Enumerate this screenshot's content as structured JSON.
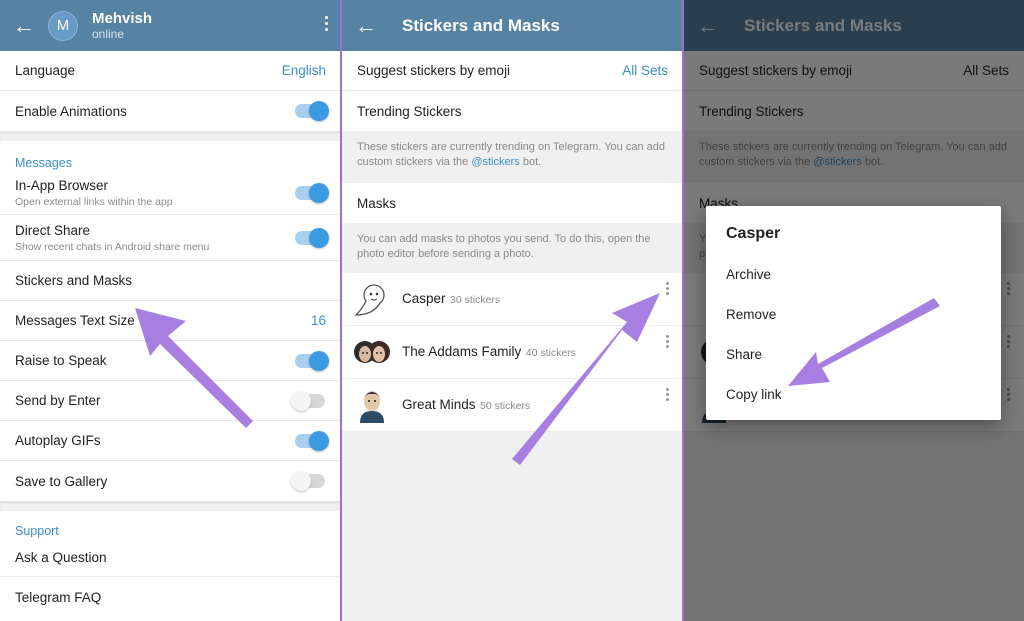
{
  "panel1": {
    "header": {
      "avatar_letter": "M",
      "name": "Mehvish",
      "status": "online"
    },
    "general": [
      {
        "label": "Language",
        "value": "English"
      },
      {
        "label": "Enable Animations",
        "toggle": "on"
      }
    ],
    "messages_section": "Messages",
    "messages": [
      {
        "label": "In-App Browser",
        "sub": "Open external links within the app",
        "toggle": "on"
      },
      {
        "label": "Direct Share",
        "sub": "Show recent chats in Android share menu",
        "toggle": "on"
      },
      {
        "label": "Stickers and Masks"
      },
      {
        "label": "Messages Text Size",
        "value": "16"
      },
      {
        "label": "Raise to Speak",
        "toggle": "on"
      },
      {
        "label": "Send by Enter",
        "toggle": "off"
      },
      {
        "label": "Autoplay GIFs",
        "toggle": "on"
      },
      {
        "label": "Save to Gallery",
        "toggle": "off"
      }
    ],
    "support_section": "Support",
    "support": [
      {
        "label": "Ask a Question"
      },
      {
        "label": "Telegram FAQ"
      }
    ]
  },
  "panel2": {
    "title": "Stickers and Masks",
    "suggest_label": "Suggest stickers by emoji",
    "suggest_value": "All Sets",
    "trending_label": "Trending Stickers",
    "trending_info_1": "These stickers are currently trending on Telegram. You can add custom stickers via the",
    "trending_info_link": "@stickers",
    "trending_info_2": "bot.",
    "masks_label": "Masks",
    "masks_info": "You can add masks to photos you send. To do this, open the photo editor before sending a photo.",
    "sets": [
      {
        "name": "Casper",
        "count": "30 stickers"
      },
      {
        "name": "The Addams Family",
        "count": "40 stickers"
      },
      {
        "name": "Great Minds",
        "count": "50 stickers"
      }
    ]
  },
  "panel3": {
    "dialog_title": "Casper",
    "dialog_items": [
      "Archive",
      "Remove",
      "Share",
      "Copy link"
    ]
  },
  "colors": {
    "header": "#5682a3",
    "accent": "#3a8fc8",
    "arrow": "#a77fe0",
    "divider": "#9b72c8"
  }
}
